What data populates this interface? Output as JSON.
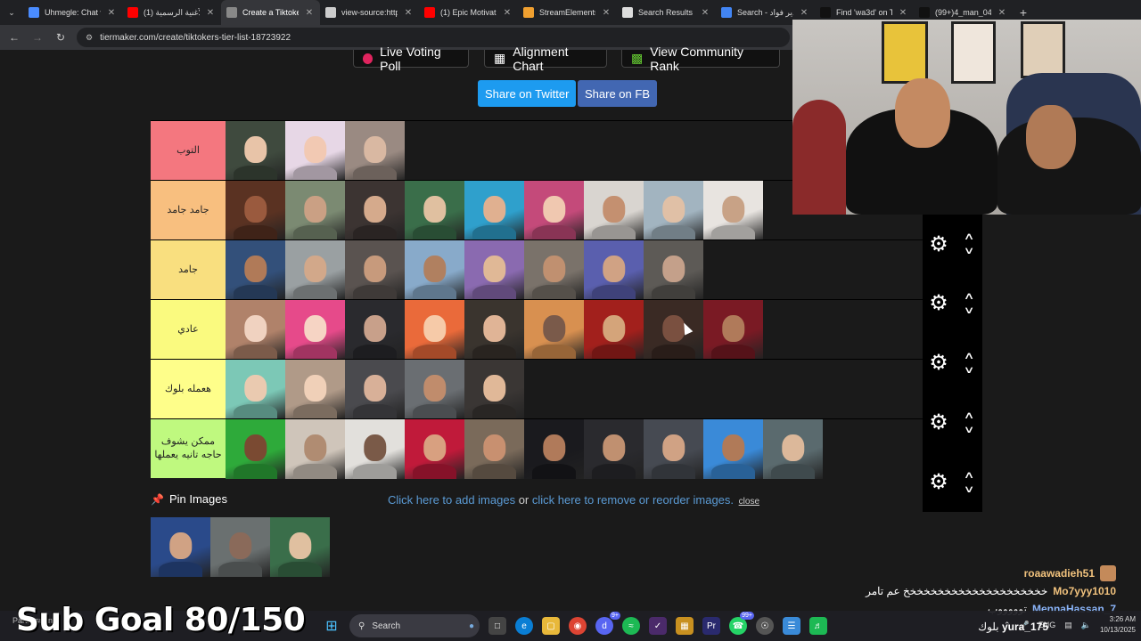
{
  "browser": {
    "tabs": [
      {
        "title": "Uhmegle: Chat wi",
        "favicon_color": "#4a8cff",
        "active": false
      },
      {
        "title": "(1) الأغنية الرسمية",
        "favicon_color": "#ff0000",
        "active": false
      },
      {
        "title": "Create a Tiktoker",
        "favicon_color": "#888888",
        "active": true
      },
      {
        "title": "view-source:https",
        "favicon_color": "#cccccc",
        "active": false
      },
      {
        "title": "(1) Epic Motivatio",
        "favicon_color": "#ff0000",
        "active": false
      },
      {
        "title": "StreamElements |",
        "favicon_color": "#f0a030",
        "active": false
      },
      {
        "title": "Search Results fo",
        "favicon_color": "#dddddd",
        "active": false
      },
      {
        "title": "Search - هدير فواد",
        "favicon_color": "#4285f4",
        "active": false
      },
      {
        "title": "Find 'wa3d' on Ti",
        "favicon_color": "#111111",
        "active": false
      },
      {
        "title": "(99+)4_man_04 (",
        "favicon_color": "#111111",
        "active": false
      }
    ],
    "url": "tiermaker.com/create/tiktokers-tier-list-18723922"
  },
  "page": {
    "top_buttons": [
      {
        "label": "Live Voting Poll"
      },
      {
        "label": "Alignment Chart"
      },
      {
        "label": "View Community Rank"
      }
    ],
    "share_twitter": "Share on Twitter",
    "share_fb": "Share on FB",
    "colors": {
      "twitter": "#1d9bf0",
      "fb": "#4267b2"
    },
    "tiers": [
      {
        "label": "التوب",
        "color": "#f4777f",
        "items": [
          [
            "#3f4a3e",
            "#e8c4a8"
          ],
          [
            "#e7d7e6",
            "#f2c9b3"
          ],
          [
            "#9a8a82",
            "#d9b8a2"
          ]
        ]
      },
      {
        "label": "جامد جامد",
        "color": "#f8bf7f",
        "items": [
          [
            "#5a3222",
            "#9a5a3e"
          ],
          [
            "#7b8a72",
            "#caa084"
          ],
          [
            "#3c3432",
            "#d5aa8c"
          ],
          [
            "#3a6e4a",
            "#e0c0a0"
          ],
          [
            "#2fa0cc",
            "#e0b090"
          ],
          [
            "#c44a7a",
            "#f0c8b0"
          ],
          [
            "#d9d5d0",
            "#c49070"
          ],
          [
            "#a2b4c0",
            "#e0c0a6"
          ],
          [
            "#e8e4e0",
            "#c8a286"
          ]
        ]
      },
      {
        "label": "جامد",
        "color": "#f9df7f",
        "items": [
          [
            "#33507a",
            "#b07a58"
          ],
          [
            "#9aa0a2",
            "#d2a88a"
          ],
          [
            "#5a5350",
            "#c79a7c"
          ],
          [
            "#88aaca",
            "#b08060"
          ],
          [
            "#8a6ab0",
            "#e0b896"
          ],
          [
            "#7a726a",
            "#c09070"
          ],
          [
            "#5a5fae",
            "#d0a284"
          ],
          [
            "#5d5a56",
            "#c4a08a"
          ]
        ]
      },
      {
        "label": "عادي",
        "color": "#fafa7f",
        "items": [
          [
            "#b0826a",
            "#f0d2c0"
          ],
          [
            "#e64a8a",
            "#f6d4c4"
          ],
          [
            "#2a2a2e",
            "#c8a08a"
          ],
          [
            "#ea6a3a",
            "#f6caa8"
          ],
          [
            "#3a342e",
            "#e0b496"
          ],
          [
            "#d89050",
            "#7a5a4a"
          ],
          [
            "#a2201c",
            "#d4a47a"
          ],
          [
            "#3a2a24",
            "#7a5040"
          ],
          [
            "#7a1a24",
            "#b07a5a"
          ]
        ]
      },
      {
        "label": "هعمله بلوك",
        "color": "#fefe8a",
        "items": [
          [
            "#7cc8b6",
            "#eacab0"
          ],
          [
            "#b09a88",
            "#f0d0b8"
          ],
          [
            "#4a4a4e",
            "#d8b098"
          ],
          [
            "#6a6e72",
            "#c08c6c"
          ],
          [
            "#3a3634",
            "#e0b898"
          ]
        ]
      },
      {
        "label": "ممكن يشوف حاجه تانيه يعملها",
        "color": "#bff97f",
        "items": [
          [
            "#2eaa3a",
            "#7a4a32"
          ],
          [
            "#cfc5ba",
            "#b08c72"
          ],
          [
            "#e2e0dc",
            "#7a5a48"
          ],
          [
            "#c01a3a",
            "#d8a080"
          ],
          [
            "#7a6a5a",
            "#c89070"
          ],
          [
            "#1a1a1e",
            "#b07a5a"
          ],
          [
            "#2a2a2e",
            "#c09070"
          ],
          [
            "#464a52",
            "#d0a284"
          ],
          [
            "#3a8ad8",
            "#b07a58"
          ],
          [
            "#5a6a6e",
            "#dcb89a"
          ]
        ]
      }
    ],
    "pin_title": "Pin Images",
    "add_images": "Click here to add images",
    "or": " or ",
    "remove_images": "click here to remove or reorder images.",
    "close": "close",
    "pins": [
      [
        "#2a4a8a",
        "#d0a284"
      ],
      [
        "#6a7070",
        "#8a6a5a"
      ],
      [
        "#3a6e4a",
        "#e0c0a0"
      ]
    ]
  },
  "stream": {
    "sub_goal": "Sub Goal 80/150",
    "chat": [
      {
        "user": "roaawadieh51",
        "msg": "",
        "emote": true,
        "user_color": "#f1c27d"
      },
      {
        "user": "Mo7yyy1010",
        "msg": "خخخخخخخخخخخخخخخخخخخخخ عم تامر",
        "emote": false,
        "user_color": "#f1c27d"
      },
      {
        "user": "MennaHassan_7",
        "msg": "توووووب",
        "emote": false,
        "user_color": "#8ab4f8"
      },
      {
        "user": "yura_175",
        "msg": "بلوك",
        "emote": false,
        "user_color": "#ffffff"
      }
    ]
  },
  "taskbar": {
    "weather": "Partly sunny",
    "search": "Search",
    "discord_badge": "9+",
    "whatsapp_badge": "99+",
    "lang": "ENG",
    "time": "3:26 AM",
    "date": "10/13/2025"
  }
}
